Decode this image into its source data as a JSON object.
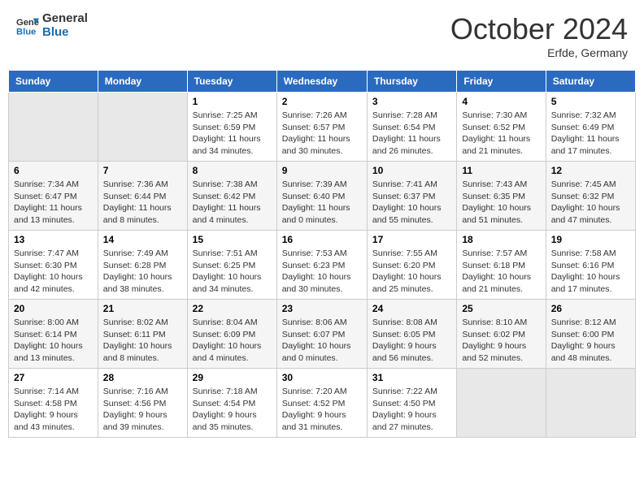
{
  "header": {
    "logo_line1": "General",
    "logo_line2": "Blue",
    "month_title": "October 2024",
    "location": "Erfde, Germany"
  },
  "days_of_week": [
    "Sunday",
    "Monday",
    "Tuesday",
    "Wednesday",
    "Thursday",
    "Friday",
    "Saturday"
  ],
  "weeks": [
    [
      {
        "num": "",
        "sunrise": "",
        "sunset": "",
        "daylight": "",
        "empty": true
      },
      {
        "num": "",
        "sunrise": "",
        "sunset": "",
        "daylight": "",
        "empty": true
      },
      {
        "num": "1",
        "sunrise": "Sunrise: 7:25 AM",
        "sunset": "Sunset: 6:59 PM",
        "daylight": "Daylight: 11 hours and 34 minutes.",
        "empty": false
      },
      {
        "num": "2",
        "sunrise": "Sunrise: 7:26 AM",
        "sunset": "Sunset: 6:57 PM",
        "daylight": "Daylight: 11 hours and 30 minutes.",
        "empty": false
      },
      {
        "num": "3",
        "sunrise": "Sunrise: 7:28 AM",
        "sunset": "Sunset: 6:54 PM",
        "daylight": "Daylight: 11 hours and 26 minutes.",
        "empty": false
      },
      {
        "num": "4",
        "sunrise": "Sunrise: 7:30 AM",
        "sunset": "Sunset: 6:52 PM",
        "daylight": "Daylight: 11 hours and 21 minutes.",
        "empty": false
      },
      {
        "num": "5",
        "sunrise": "Sunrise: 7:32 AM",
        "sunset": "Sunset: 6:49 PM",
        "daylight": "Daylight: 11 hours and 17 minutes.",
        "empty": false
      }
    ],
    [
      {
        "num": "6",
        "sunrise": "Sunrise: 7:34 AM",
        "sunset": "Sunset: 6:47 PM",
        "daylight": "Daylight: 11 hours and 13 minutes.",
        "empty": false
      },
      {
        "num": "7",
        "sunrise": "Sunrise: 7:36 AM",
        "sunset": "Sunset: 6:44 PM",
        "daylight": "Daylight: 11 hours and 8 minutes.",
        "empty": false
      },
      {
        "num": "8",
        "sunrise": "Sunrise: 7:38 AM",
        "sunset": "Sunset: 6:42 PM",
        "daylight": "Daylight: 11 hours and 4 minutes.",
        "empty": false
      },
      {
        "num": "9",
        "sunrise": "Sunrise: 7:39 AM",
        "sunset": "Sunset: 6:40 PM",
        "daylight": "Daylight: 11 hours and 0 minutes.",
        "empty": false
      },
      {
        "num": "10",
        "sunrise": "Sunrise: 7:41 AM",
        "sunset": "Sunset: 6:37 PM",
        "daylight": "Daylight: 10 hours and 55 minutes.",
        "empty": false
      },
      {
        "num": "11",
        "sunrise": "Sunrise: 7:43 AM",
        "sunset": "Sunset: 6:35 PM",
        "daylight": "Daylight: 10 hours and 51 minutes.",
        "empty": false
      },
      {
        "num": "12",
        "sunrise": "Sunrise: 7:45 AM",
        "sunset": "Sunset: 6:32 PM",
        "daylight": "Daylight: 10 hours and 47 minutes.",
        "empty": false
      }
    ],
    [
      {
        "num": "13",
        "sunrise": "Sunrise: 7:47 AM",
        "sunset": "Sunset: 6:30 PM",
        "daylight": "Daylight: 10 hours and 42 minutes.",
        "empty": false
      },
      {
        "num": "14",
        "sunrise": "Sunrise: 7:49 AM",
        "sunset": "Sunset: 6:28 PM",
        "daylight": "Daylight: 10 hours and 38 minutes.",
        "empty": false
      },
      {
        "num": "15",
        "sunrise": "Sunrise: 7:51 AM",
        "sunset": "Sunset: 6:25 PM",
        "daylight": "Daylight: 10 hours and 34 minutes.",
        "empty": false
      },
      {
        "num": "16",
        "sunrise": "Sunrise: 7:53 AM",
        "sunset": "Sunset: 6:23 PM",
        "daylight": "Daylight: 10 hours and 30 minutes.",
        "empty": false
      },
      {
        "num": "17",
        "sunrise": "Sunrise: 7:55 AM",
        "sunset": "Sunset: 6:20 PM",
        "daylight": "Daylight: 10 hours and 25 minutes.",
        "empty": false
      },
      {
        "num": "18",
        "sunrise": "Sunrise: 7:57 AM",
        "sunset": "Sunset: 6:18 PM",
        "daylight": "Daylight: 10 hours and 21 minutes.",
        "empty": false
      },
      {
        "num": "19",
        "sunrise": "Sunrise: 7:58 AM",
        "sunset": "Sunset: 6:16 PM",
        "daylight": "Daylight: 10 hours and 17 minutes.",
        "empty": false
      }
    ],
    [
      {
        "num": "20",
        "sunrise": "Sunrise: 8:00 AM",
        "sunset": "Sunset: 6:14 PM",
        "daylight": "Daylight: 10 hours and 13 minutes.",
        "empty": false
      },
      {
        "num": "21",
        "sunrise": "Sunrise: 8:02 AM",
        "sunset": "Sunset: 6:11 PM",
        "daylight": "Daylight: 10 hours and 8 minutes.",
        "empty": false
      },
      {
        "num": "22",
        "sunrise": "Sunrise: 8:04 AM",
        "sunset": "Sunset: 6:09 PM",
        "daylight": "Daylight: 10 hours and 4 minutes.",
        "empty": false
      },
      {
        "num": "23",
        "sunrise": "Sunrise: 8:06 AM",
        "sunset": "Sunset: 6:07 PM",
        "daylight": "Daylight: 10 hours and 0 minutes.",
        "empty": false
      },
      {
        "num": "24",
        "sunrise": "Sunrise: 8:08 AM",
        "sunset": "Sunset: 6:05 PM",
        "daylight": "Daylight: 9 hours and 56 minutes.",
        "empty": false
      },
      {
        "num": "25",
        "sunrise": "Sunrise: 8:10 AM",
        "sunset": "Sunset: 6:02 PM",
        "daylight": "Daylight: 9 hours and 52 minutes.",
        "empty": false
      },
      {
        "num": "26",
        "sunrise": "Sunrise: 8:12 AM",
        "sunset": "Sunset: 6:00 PM",
        "daylight": "Daylight: 9 hours and 48 minutes.",
        "empty": false
      }
    ],
    [
      {
        "num": "27",
        "sunrise": "Sunrise: 7:14 AM",
        "sunset": "Sunset: 4:58 PM",
        "daylight": "Daylight: 9 hours and 43 minutes.",
        "empty": false
      },
      {
        "num": "28",
        "sunrise": "Sunrise: 7:16 AM",
        "sunset": "Sunset: 4:56 PM",
        "daylight": "Daylight: 9 hours and 39 minutes.",
        "empty": false
      },
      {
        "num": "29",
        "sunrise": "Sunrise: 7:18 AM",
        "sunset": "Sunset: 4:54 PM",
        "daylight": "Daylight: 9 hours and 35 minutes.",
        "empty": false
      },
      {
        "num": "30",
        "sunrise": "Sunrise: 7:20 AM",
        "sunset": "Sunset: 4:52 PM",
        "daylight": "Daylight: 9 hours and 31 minutes.",
        "empty": false
      },
      {
        "num": "31",
        "sunrise": "Sunrise: 7:22 AM",
        "sunset": "Sunset: 4:50 PM",
        "daylight": "Daylight: 9 hours and 27 minutes.",
        "empty": false
      },
      {
        "num": "",
        "sunrise": "",
        "sunset": "",
        "daylight": "",
        "empty": true
      },
      {
        "num": "",
        "sunrise": "",
        "sunset": "",
        "daylight": "",
        "empty": true
      }
    ]
  ]
}
